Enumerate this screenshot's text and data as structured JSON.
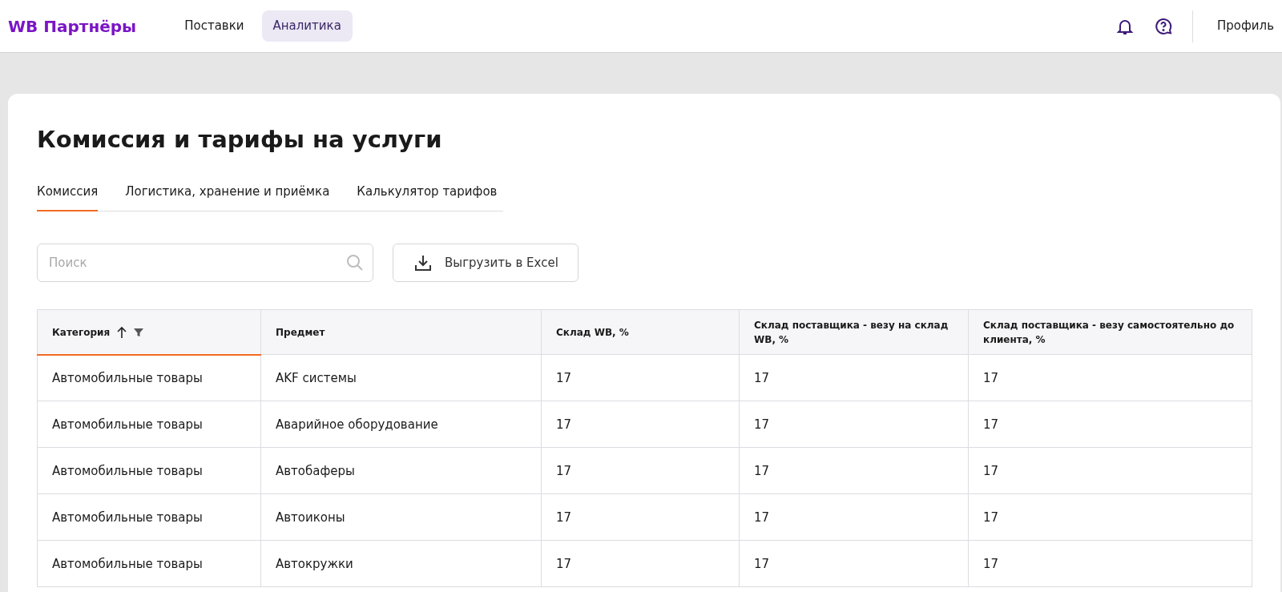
{
  "header": {
    "logo": "WB Партнёры",
    "nav": [
      {
        "label": "Поставки",
        "selected": false
      },
      {
        "label": "Аналитика",
        "selected": true
      }
    ],
    "profile": "Профиль"
  },
  "page_title": "Комиссия и тарифы на услуги",
  "tabs": [
    {
      "label": "Комиссия",
      "selected": true
    },
    {
      "label": "Логистика, хранение и приёмка",
      "selected": false
    },
    {
      "label": "Калькулятор тарифов",
      "selected": false
    }
  ],
  "search": {
    "placeholder": "Поиск"
  },
  "export_button": "Выгрузить в Excel",
  "table": {
    "columns": [
      {
        "label": "Категория",
        "sorted": true
      },
      {
        "label": "Предмет",
        "sorted": false
      },
      {
        "label": "Склад WB, %",
        "sorted": false
      },
      {
        "label": "Склад поставщика - везу на склад WB, %",
        "sorted": false
      },
      {
        "label": "Склад поставщика - везу самостоятельно до клиента, %",
        "sorted": false
      }
    ],
    "rows": [
      [
        "Автомобильные товары",
        "AKF системы",
        "17",
        "17",
        "17"
      ],
      [
        "Автомобильные товары",
        "Аварийное оборудование",
        "17",
        "17",
        "17"
      ],
      [
        "Автомобильные товары",
        "Автобаферы",
        "17",
        "17",
        "17"
      ],
      [
        "Автомобильные товары",
        "Автоиконы",
        "17",
        "17",
        "17"
      ],
      [
        "Автомобильные товары",
        "Автокружки",
        "17",
        "17",
        "17"
      ]
    ]
  }
}
